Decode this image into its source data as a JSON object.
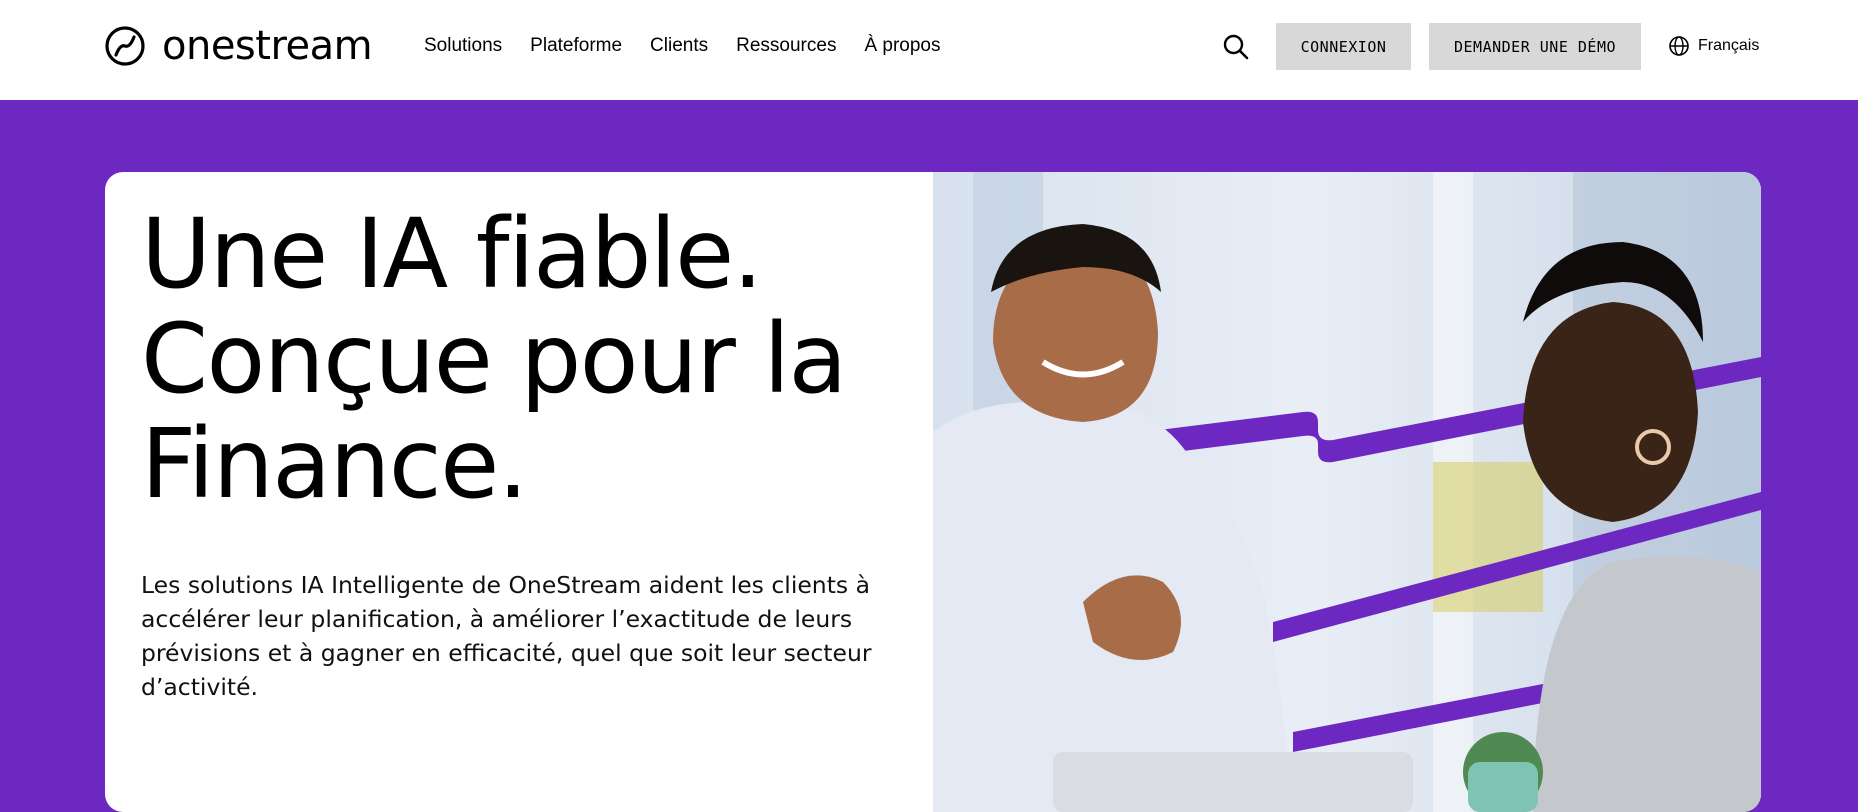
{
  "brand": {
    "name": "onestream"
  },
  "nav": {
    "items": [
      "Solutions",
      "Plateforme",
      "Clients",
      "Ressources",
      "À propos"
    ]
  },
  "header": {
    "login_label": "CONNEXION",
    "demo_label": "DEMANDER UNE DÉMO",
    "language_label": "Français"
  },
  "hero": {
    "headline_lines": [
      "Une IA fiable.",
      "Conçue pour la",
      "Finance."
    ],
    "description": "Les solutions IA Intelligente de OneStream aident les clients à accélérer leur planification, à améliorer l’exactitude de leurs prévisions et à gagner en efficacité, quel que soit leur secteur d’activité."
  },
  "icons": {
    "logo": "onestream-logo-mark",
    "search": "search-icon",
    "language": "globe-icon"
  },
  "colors": {
    "brand_purple": "#6e28c2",
    "button_gray": "#d8d8d8"
  }
}
